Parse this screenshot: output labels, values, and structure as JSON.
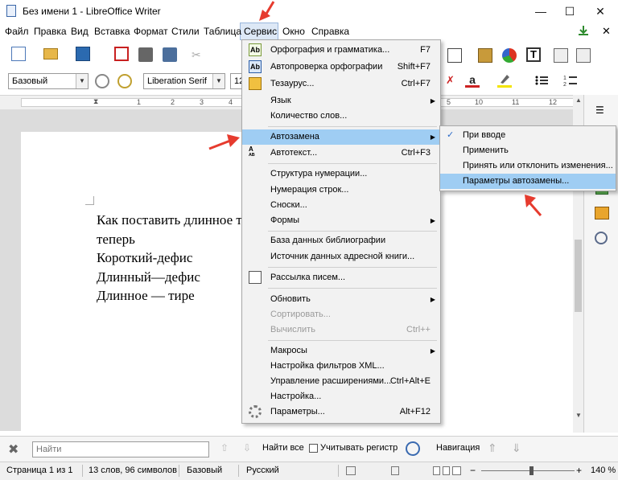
{
  "window": {
    "title": "Без имени 1 - LibreOffice Writer",
    "minimize": "—",
    "maximize": "☐",
    "close": "✕"
  },
  "menubar": [
    "Файл",
    "Правка",
    "Вид",
    "Вставка",
    "Формат",
    "Стили",
    "Таблица",
    "Сервис",
    "Окно",
    "Справка"
  ],
  "toolbar": {
    "para_style": "Базовый",
    "font_name": "Liberation Serif",
    "font_size": "12"
  },
  "ruler": {
    "marks": [
      "1",
      "2",
      "3",
      "4",
      "5",
      "10",
      "11",
      "12"
    ]
  },
  "document": {
    "lines": [
      "Как поставить длинное тире",
      "теперь",
      "Короткий-дефис",
      "Длинный—дефис",
      "Длинное — тире"
    ]
  },
  "service_menu": {
    "items": [
      {
        "label": "Орфография и грамматика...",
        "shortcut": "F7"
      },
      {
        "label": "Автопроверка орфографии",
        "shortcut": "Shift+F7"
      },
      {
        "label": "Тезаурус...",
        "shortcut": "Ctrl+F7"
      },
      {
        "label": "Язык",
        "shortcut": ""
      },
      {
        "label": "Количество слов...",
        "shortcut": ""
      },
      {
        "label": "Автозамена",
        "shortcut": ""
      },
      {
        "label": "Автотекст...",
        "shortcut": "Ctrl+F3"
      },
      {
        "label": "Структура нумерации...",
        "shortcut": ""
      },
      {
        "label": "Нумерация строк...",
        "shortcut": ""
      },
      {
        "label": "Сноски...",
        "shortcut": ""
      },
      {
        "label": "Формы",
        "shortcut": ""
      },
      {
        "label": "База данных библиографии",
        "shortcut": ""
      },
      {
        "label": "Источник данных адресной книги...",
        "shortcut": ""
      },
      {
        "label": "Рассылка писем...",
        "shortcut": ""
      },
      {
        "label": "Обновить",
        "shortcut": ""
      },
      {
        "label": "Сортировать...",
        "shortcut": ""
      },
      {
        "label": "Вычислить",
        "shortcut": "Ctrl++"
      },
      {
        "label": "Макросы",
        "shortcut": ""
      },
      {
        "label": "Настройка фильтров XML...",
        "shortcut": ""
      },
      {
        "label": "Управление расширениями...",
        "shortcut": "Ctrl+Alt+E"
      },
      {
        "label": "Настройка...",
        "shortcut": ""
      },
      {
        "label": "Параметры...",
        "shortcut": "Alt+F12"
      }
    ]
  },
  "autocorrect_submenu": {
    "items": [
      "При вводе",
      "Применить",
      "Принять или отклонить изменения...",
      "Параметры автозамены..."
    ],
    "checkmark": "✓"
  },
  "findbar": {
    "placeholder": "Найти",
    "find_all": "Найти все",
    "match_case": "Учитывать регистр",
    "navigation": "Навигация"
  },
  "statusbar": {
    "page": "Страница 1 из 1",
    "words": "13 слов, 96 символов",
    "style": "Базовый",
    "language": "Русский",
    "zoom": "140 %"
  },
  "colors": {
    "highlight": "#9fcdf3",
    "menu_bg": "#f2f2f2",
    "annotation_arrow": "#e63b2e"
  }
}
